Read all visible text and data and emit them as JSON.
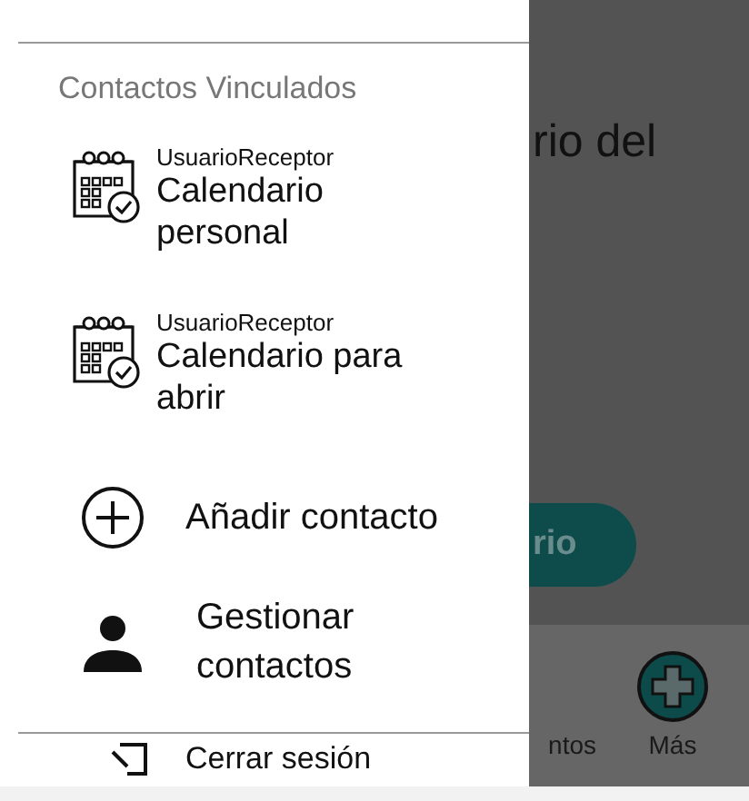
{
  "background": {
    "title": "rio del",
    "button": "rio",
    "nav": [
      {
        "label": "ntos",
        "kind": "plain"
      },
      {
        "label": "Más",
        "kind": "add"
      }
    ]
  },
  "drawer": {
    "section_title": "Contactos Vinculados",
    "calendars": [
      {
        "owner": "UsuarioReceptor",
        "name": "Calendario personal"
      },
      {
        "owner": "UsuarioReceptor",
        "name": "Calendario para abrir"
      }
    ],
    "actions": [
      {
        "label": "Añadir contacto",
        "kind": "add"
      },
      {
        "label": "Gestionar contactos",
        "kind": "person"
      }
    ],
    "footer_actions": [
      {
        "label": "Cerrar sesión",
        "kind": "logout"
      }
    ]
  }
}
